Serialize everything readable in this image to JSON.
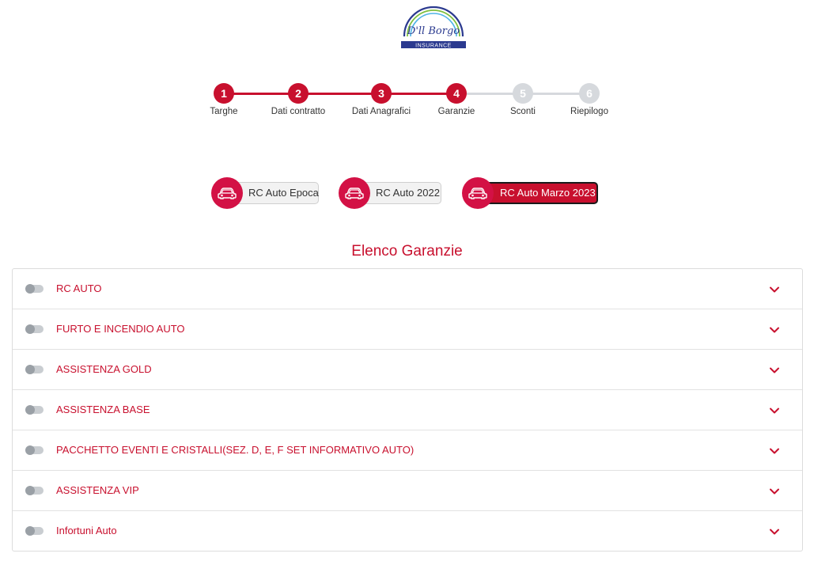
{
  "logo": {
    "script_text": "Dall'Borgo",
    "banner_text": "INSURANCE"
  },
  "stepper": {
    "steps": [
      {
        "number": "1",
        "label": "Targhe",
        "state": "complete"
      },
      {
        "number": "2",
        "label": "Dati contratto",
        "state": "complete"
      },
      {
        "number": "3",
        "label": "Dati Anagrafici",
        "state": "complete"
      },
      {
        "number": "4",
        "label": "Garanzie",
        "state": "current"
      },
      {
        "number": "5",
        "label": "Sconti",
        "state": "pending"
      },
      {
        "number": "6",
        "label": "Riepilogo",
        "state": "pending"
      }
    ]
  },
  "products": [
    {
      "label": "RC Auto Epoca",
      "icon": "car-icon",
      "selected": false
    },
    {
      "label": "RC Auto 2022",
      "icon": "car-icon",
      "selected": false
    },
    {
      "label": "RC Auto Marzo 2023",
      "icon": "car-icon",
      "selected": true
    }
  ],
  "section": {
    "title": "Elenco Garanzie"
  },
  "guarantees": [
    {
      "label": "RC AUTO",
      "enabled": false
    },
    {
      "label": "FURTO E INCENDIO AUTO",
      "enabled": false
    },
    {
      "label": "ASSISTENZA GOLD",
      "enabled": false
    },
    {
      "label": "ASSISTENZA BASE",
      "enabled": false
    },
    {
      "label": "PACCHETTO EVENTI E CRISTALLI(SEZ. D, E, F SET INFORMATIVO AUTO)",
      "enabled": false
    },
    {
      "label": "ASSISTENZA VIP",
      "enabled": false
    },
    {
      "label": "Infortuni Auto",
      "enabled": false
    }
  ],
  "colors": {
    "accent": "#c8102e",
    "step_complete": "#c8102e",
    "step_pending": "#d6d9dd",
    "logo_blue": "#2b3a8f"
  }
}
